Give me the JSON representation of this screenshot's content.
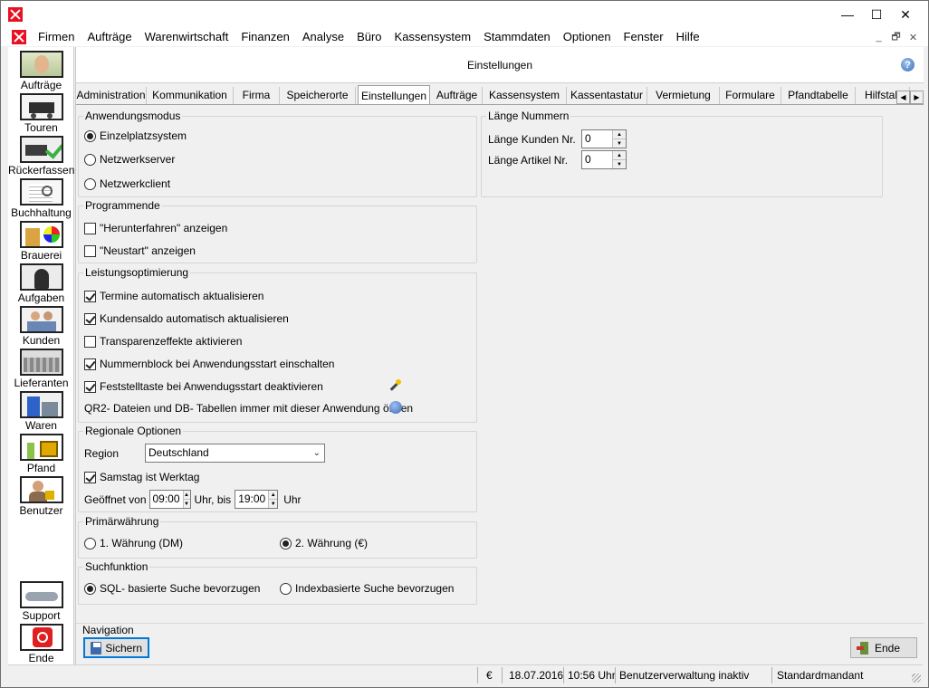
{
  "window": {
    "close_label": "✕",
    "maximize_label": "☐",
    "minimize_label": "—"
  },
  "menu": [
    "Firmen",
    "Aufträge",
    "Warenwirtschaft",
    "Finanzen",
    "Analyse",
    "Büro",
    "Kassensystem",
    "Stammdaten",
    "Optionen",
    "Fenster",
    "Hilfe"
  ],
  "mdi": {
    "minimize": "_",
    "restore": "🗗",
    "close": "✕"
  },
  "sidebar": {
    "items": [
      "Aufträge",
      "Touren",
      "Rückerfassen",
      "Buchhaltung",
      "Brauerei",
      "Aufgaben",
      "Kunden",
      "Lieferanten",
      "Waren",
      "Pfand",
      "Benutzer"
    ],
    "bottom": [
      "Support",
      "Ende"
    ]
  },
  "panel": {
    "title": "Einstellungen",
    "help": "?"
  },
  "tabs": [
    "Administration",
    "Kommunikation",
    "Firma",
    "Speicherorte",
    "Einstellungen",
    "Aufträge",
    "Kassensystem",
    "Kassentastatur",
    "Vermietung",
    "Formulare",
    "Pfandtabelle",
    "Hilfstab"
  ],
  "tab_scroll": {
    "left": "◀",
    "right": "▶"
  },
  "anwendungsmodus": {
    "title": "Anwendungsmodus",
    "options": [
      "Einzelplatzsystem",
      "Netzwerkserver",
      "Netzwerkclient"
    ]
  },
  "laenge": {
    "title": "Länge Nummern",
    "kunden_label": "Länge Kunden Nr.",
    "kunden_value": "0",
    "artikel_label": "Länge Artikel Nr.",
    "artikel_value": "0"
  },
  "programmende": {
    "title": "Programmende",
    "items": [
      "\"Herunterfahren\" anzeigen",
      "\"Neustart\" anzeigen"
    ]
  },
  "leistung": {
    "title": "Leistungsoptimierung",
    "items": [
      "Termine automatisch aktualisieren",
      "Kundensaldo automatisch aktualisieren",
      "Transparenzeffekte aktivieren",
      "Nummernblock bei Anwendungsstart einschalten",
      "Feststelltaste bei Anwendugsstart deaktivieren"
    ],
    "qr2_text": "QR2- Dateien und DB- Tabellen immer mit dieser Anwendung öffnen"
  },
  "regional": {
    "title": "Regionale Optionen",
    "region_label": "Region",
    "region_value": "Deutschland",
    "samstag_label": "Samstag ist Werktag",
    "geoeffnet_label": "Geöffnet von",
    "from_value": "09:00",
    "bis_label": "Uhr, bis",
    "to_value": "19:00",
    "uhr_label": "Uhr"
  },
  "waehrung": {
    "title": "Primärwährung",
    "option1": "1. Währung (DM)",
    "option2": "2. Währung (€)"
  },
  "suche": {
    "title": "Suchfunktion",
    "option1": "SQL- basierte Suche bevorzugen",
    "option2": "Indexbasierte Suche bevorzugen"
  },
  "navigation": {
    "title": "Navigation",
    "save_label": "Sichern",
    "end_label": "Ende"
  },
  "status": {
    "currency": "€",
    "date": "18.07.2016",
    "time": "10:56 Uhr",
    "user_mgmt": "Benutzerverwaltung inaktiv",
    "mandant": "Standardmandant"
  },
  "colors": {
    "accent": "#0078d7",
    "app_icon": "#e81123"
  }
}
